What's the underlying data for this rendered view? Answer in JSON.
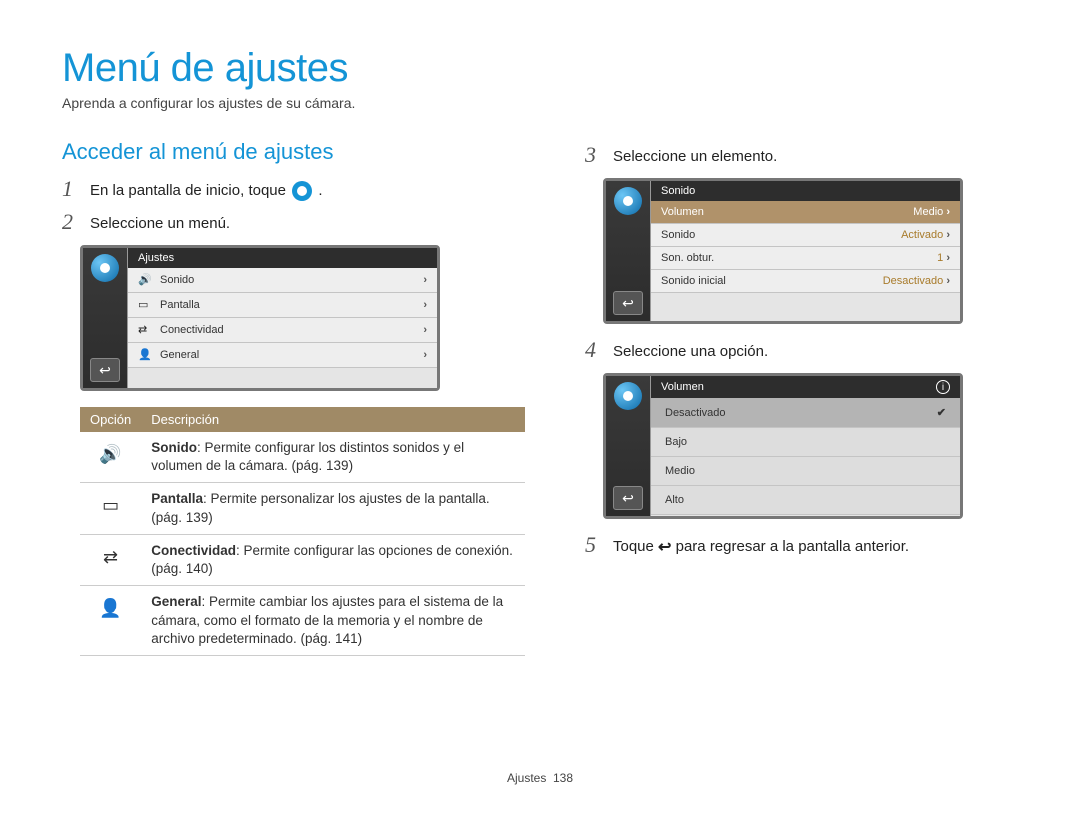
{
  "title": "Menú de ajustes",
  "intro": "Aprenda a configurar los ajustes de su cámara.",
  "section": "Acceder al menú de ajustes",
  "steps": {
    "s1_a": "En la pantalla de inicio, toque ",
    "s1_b": ".",
    "s2": "Seleccione un menú.",
    "s3": "Seleccione un elemento.",
    "s4": "Seleccione una opción.",
    "s5_a": "Toque ",
    "s5_b": " para regresar a la pantalla anterior."
  },
  "device1": {
    "title": "Ajustes",
    "rows": [
      {
        "icon": "sound-icon",
        "label": "Sonido"
      },
      {
        "icon": "display-icon",
        "label": "Pantalla"
      },
      {
        "icon": "connect-icon",
        "label": "Conectividad"
      },
      {
        "icon": "general-icon",
        "label": "General"
      }
    ]
  },
  "desc": {
    "headers": {
      "opt": "Opción",
      "desc": "Descripción"
    },
    "rows": [
      {
        "icon": "sound-icon",
        "bold": "Sonido",
        "text": ": Permite configurar los distintos sonidos y el volumen de la cámara. (pág. 139)"
      },
      {
        "icon": "display-icon",
        "bold": "Pantalla",
        "text": ": Permite personalizar los ajustes de la pantalla. (pág. 139)"
      },
      {
        "icon": "connect-icon",
        "bold": "Conectividad",
        "text": ": Permite configurar las opciones de conexión. (pág. 140)"
      },
      {
        "icon": "general-icon",
        "bold": "General",
        "text": ": Permite cambiar los ajustes para el sistema de la cámara, como el formato de la memoria y el nombre de archivo predeterminado. (pág. 141)"
      }
    ]
  },
  "device2": {
    "title": "Sonido",
    "rows": [
      {
        "label": "Volumen",
        "value": "Medio"
      },
      {
        "label": "Sonido",
        "value": "Activado"
      },
      {
        "label": "Son. obtur.",
        "value": "1"
      },
      {
        "label": "Sonido inicial",
        "value": "Desactivado"
      }
    ]
  },
  "device3": {
    "title": "Volumen",
    "options": [
      {
        "label": "Desactivado",
        "selected": true
      },
      {
        "label": "Bajo",
        "selected": false
      },
      {
        "label": "Medio",
        "selected": false
      },
      {
        "label": "Alto",
        "selected": false
      }
    ]
  },
  "footer": {
    "label": "Ajustes",
    "page": "138"
  },
  "glyph": {
    "back": "↩",
    "chev": "›",
    "check": "✔",
    "info": "i"
  }
}
